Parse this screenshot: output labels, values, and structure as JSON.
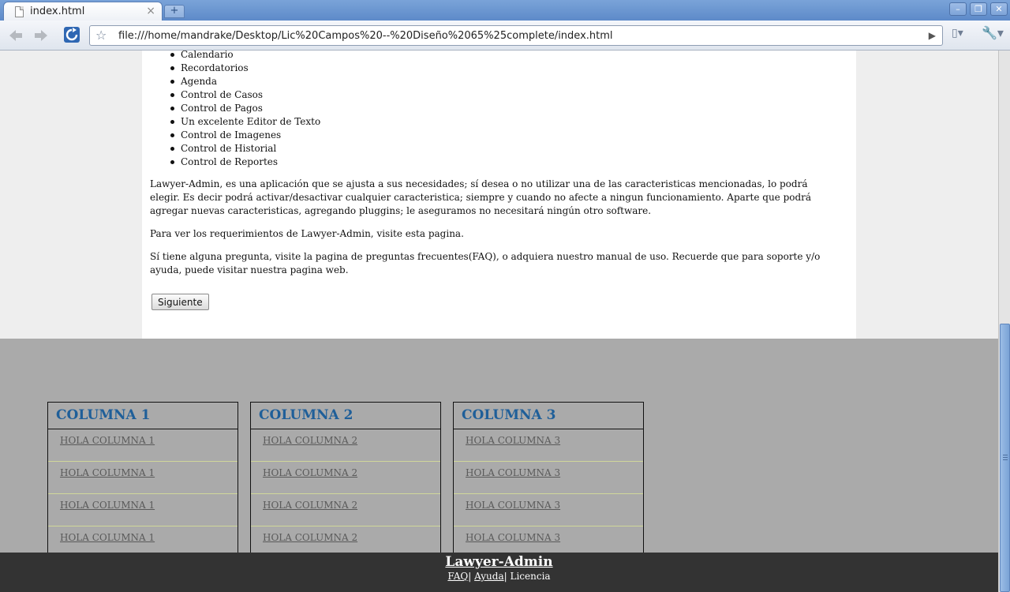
{
  "browser": {
    "tab_title": "index.html",
    "tab_close": "×",
    "new_tab": "+",
    "url": "file:///home/mandrake/Desktop/Lic%20Campos%20--%20Diseño%2065%25complete/index.html",
    "window_controls": {
      "minimize": "–",
      "restore": "❐",
      "close": "✕"
    },
    "icons": [
      "page-icon",
      "back-arrow-icon",
      "forward-arrow-icon",
      "reload-icon",
      "star-icon",
      "go-arrow-icon",
      "page-menu-icon",
      "wrench-icon"
    ]
  },
  "content": {
    "features": [
      "Calendario",
      "Recordatorios",
      "Agenda",
      "Control de Casos",
      "Control de Pagos",
      "Un excelente Editor de Texto",
      "Control de Imagenes",
      "Control de Historial",
      "Control de Reportes"
    ],
    "paragraphs": [
      "Lawyer-Admin, es una aplicación que se ajusta a sus necesidades; sí desea o no utilizar una de las caracteristicas mencionadas, lo podrá elegir. Es decir podrá activar/desactivar cualquier caracteristica; siempre y cuando no afecte a ningun funcionamiento. Aparte que podrá agregar nuevas caracteristicas, agregando pluggins; le aseguramos no necesitará ningún otro software.",
      "Para ver los requerimientos de Lawyer-Admin, visite esta pagina.",
      "Sí tiene alguna pregunta, visite la pagina de preguntas frecuentes(FAQ), o adquiera nuestro manual de uso. Recuerde que para soporte y/o ayuda, puede visitar nuestra pagina web."
    ],
    "next_button": "Siguiente"
  },
  "columns": [
    {
      "title": "COLUMNA 1",
      "items": [
        "HOLA COLUMNA 1",
        "HOLA COLUMNA 1",
        "HOLA COLUMNA 1",
        "HOLA COLUMNA 1"
      ]
    },
    {
      "title": "COLUMNA 2",
      "items": [
        "HOLA COLUMNA 2",
        "HOLA COLUMNA 2",
        "HOLA COLUMNA 2",
        "HOLA COLUMNA 2"
      ]
    },
    {
      "title": "COLUMNA 3",
      "items": [
        "HOLA COLUMNA 3",
        "HOLA COLUMNA 3",
        "HOLA COLUMNA 3",
        "HOLA COLUMNA 3"
      ]
    }
  ],
  "footer": {
    "title": "Lawyer-Admin",
    "links": [
      "FAQ",
      "Ayuda"
    ],
    "separator": "|",
    "plain": "Licencia"
  },
  "colors": {
    "column_title": "#1f5f99",
    "footer_bg": "#333333",
    "page_bg": "#aaaaaa"
  }
}
